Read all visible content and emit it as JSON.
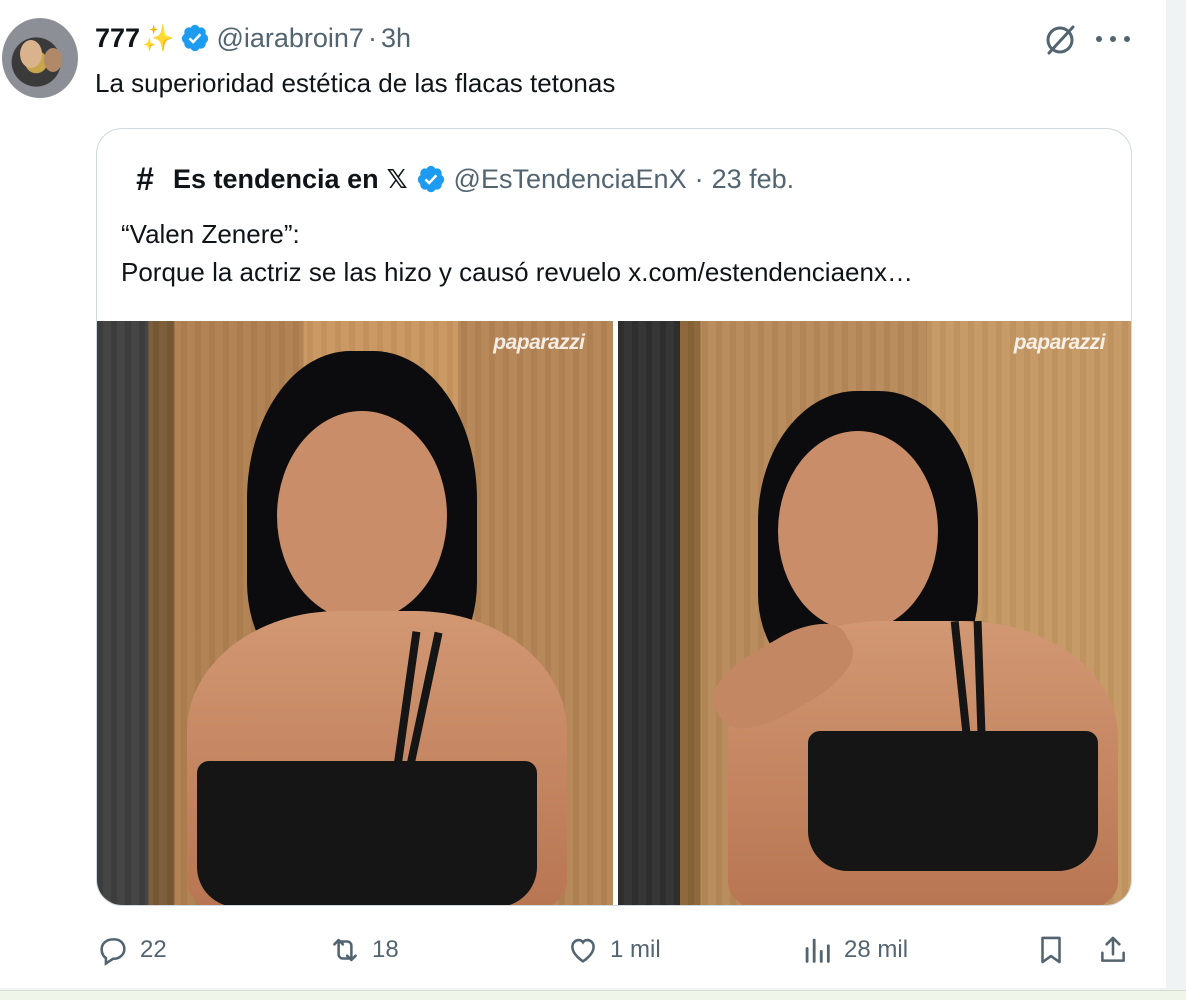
{
  "tweet": {
    "display_name": "777",
    "name_emoji": "✨",
    "handle": "@iarabroin7",
    "separator": "·",
    "time": "3h",
    "text": "La superioridad estética de las flacas tetonas"
  },
  "quoted_tweet": {
    "avatar_glyph": "#",
    "display_name": "Es tendencia en",
    "name_x": "𝕏",
    "handle": "@EsTendenciaEnX",
    "separator": "·",
    "date": "23 feb.",
    "text_line_1": "“Valen Zenere”:",
    "text_line_2": "Porque la actriz se las hizo y causó revuelo  x.com/estendenciaenx…",
    "photos": [
      {
        "watermark": "paparazzi"
      },
      {
        "watermark": "paparazzi"
      }
    ]
  },
  "actions": {
    "replies": "22",
    "reposts": "18",
    "likes": "1 mil",
    "views": "28 mil"
  },
  "colors": {
    "verified_blue": "#1d9bf0",
    "secondary_text": "#536471",
    "border": "#cfd9de"
  }
}
